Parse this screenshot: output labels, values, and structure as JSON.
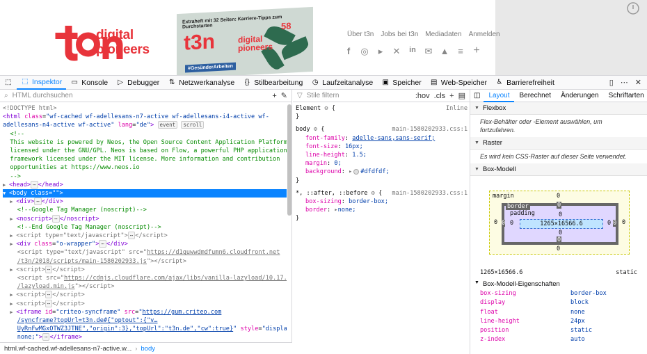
{
  "site": {
    "logo_text": "t3n",
    "tagline_line1": "digital",
    "tagline_line2": "pioneers",
    "magazine": {
      "headline": "Extraheft mit 32 Seiten: Karriere-Tipps zum Durchstarten",
      "logo": "t3n",
      "logo_sub1": "digital",
      "logo_sub2": "pioneers",
      "issue": "58",
      "hashtag": "#GesünderArbeiten"
    },
    "nav": [
      "Über t3n",
      "Jobs bei t3n",
      "Mediadaten",
      "Anmelden"
    ],
    "social_icons": [
      {
        "name": "facebook-icon",
        "glyph": "f"
      },
      {
        "name": "instagram-icon",
        "glyph": "◎"
      },
      {
        "name": "twitter-icon",
        "glyph": "🐦"
      },
      {
        "name": "xing-icon",
        "glyph": "✕"
      },
      {
        "name": "linkedin-icon",
        "glyph": "in"
      },
      {
        "name": "mail-icon",
        "glyph": "✉"
      },
      {
        "name": "bell-icon",
        "glyph": "🔔"
      },
      {
        "name": "list-icon",
        "glyph": "≡"
      },
      {
        "name": "plus-icon",
        "glyph": "+"
      }
    ]
  },
  "toolbar": {
    "tabs": [
      {
        "label": "Inspektor",
        "icon": "inspector-icon",
        "glyph": "⬚",
        "active": true
      },
      {
        "label": "Konsole",
        "icon": "console-icon",
        "glyph": "▭",
        "active": false
      },
      {
        "label": "Debugger",
        "icon": "debugger-icon",
        "glyph": "▷",
        "active": false
      },
      {
        "label": "Netzwerkanalyse",
        "icon": "network-icon",
        "glyph": "⇅",
        "active": false
      },
      {
        "label": "Stilbearbeitung",
        "icon": "style-editor-icon",
        "glyph": "{}",
        "active": false
      },
      {
        "label": "Laufzeitanalyse",
        "icon": "performance-icon",
        "glyph": "◷",
        "active": false
      },
      {
        "label": "Speicher",
        "icon": "memory-icon",
        "glyph": "▣",
        "active": false
      },
      {
        "label": "Web-Speicher",
        "icon": "storage-icon",
        "glyph": "▤",
        "active": false
      },
      {
        "label": "Barrierefreiheit",
        "icon": "accessibility-icon",
        "glyph": "♿",
        "active": false
      }
    ]
  },
  "inspector": {
    "search_placeholder": "HTML durchsuchen",
    "breadcrumb_parent": "html.wf-cached.wf-adellesans-n7-active.w...",
    "breadcrumb_sep": "›",
    "breadcrumb_current": "body"
  },
  "rules": {
    "filter_placeholder": "Stile filtern",
    "hov": ":hov",
    "cls": ".cls",
    "element_label": "Element",
    "element_brace": "{",
    "element_close": "}",
    "inline": "Inline",
    "body_selector": "body",
    "body_source": "main-1580202933.css:1",
    "body_props": [
      {
        "name": "font-family",
        "value": "adelle-sans,sans-serif;"
      },
      {
        "name": "font-size",
        "value": "16px;"
      },
      {
        "name": "line-height",
        "value": "1.5;"
      },
      {
        "name": "margin",
        "value": "0;"
      },
      {
        "name": "background",
        "value": "#dfdfdf;"
      }
    ],
    "star_selector": "*, ::after, ::before",
    "star_source": "main-1580202933.css:1",
    "star_props": [
      {
        "name": "box-sizing",
        "value": "border-box;"
      },
      {
        "name": "border",
        "value": "none;"
      }
    ]
  },
  "layout": {
    "tabs": [
      "Layout",
      "Berechnet",
      "Änderungen",
      "Schriftarten"
    ],
    "flexbox_title": "Flexbox",
    "flexbox_text": "Flex-Behälter oder -Element auswählen, um fortzufahren.",
    "grid_title": "Raster",
    "grid_text": "Es wird kein CSS-Raster auf dieser Seite verwendet.",
    "boxmodel_title": "Box-Modell",
    "bm": {
      "margin_label": "margin",
      "border_label": "border",
      "padding_label": "padding",
      "content": "1265×16566.6",
      "margin_top": "0",
      "margin_right": "0",
      "margin_bottom": "0",
      "margin_left": "0",
      "border_top": "0",
      "border_right": "0",
      "border_bottom": "0",
      "border_left": "0",
      "padding_top": "0",
      "padding_right": "0",
      "padding_bottom": "0",
      "padding_left": "0"
    },
    "dims": "1265×16566.6",
    "position": "static",
    "props_title": "Box-Modell-Eigenschaften",
    "props": [
      {
        "k": "box-sizing",
        "v": "border-box"
      },
      {
        "k": "display",
        "v": "block"
      },
      {
        "k": "float",
        "v": "none"
      },
      {
        "k": "line-height",
        "v": "24px"
      },
      {
        "k": "position",
        "v": "static"
      },
      {
        "k": "z-index",
        "v": "auto"
      }
    ]
  }
}
